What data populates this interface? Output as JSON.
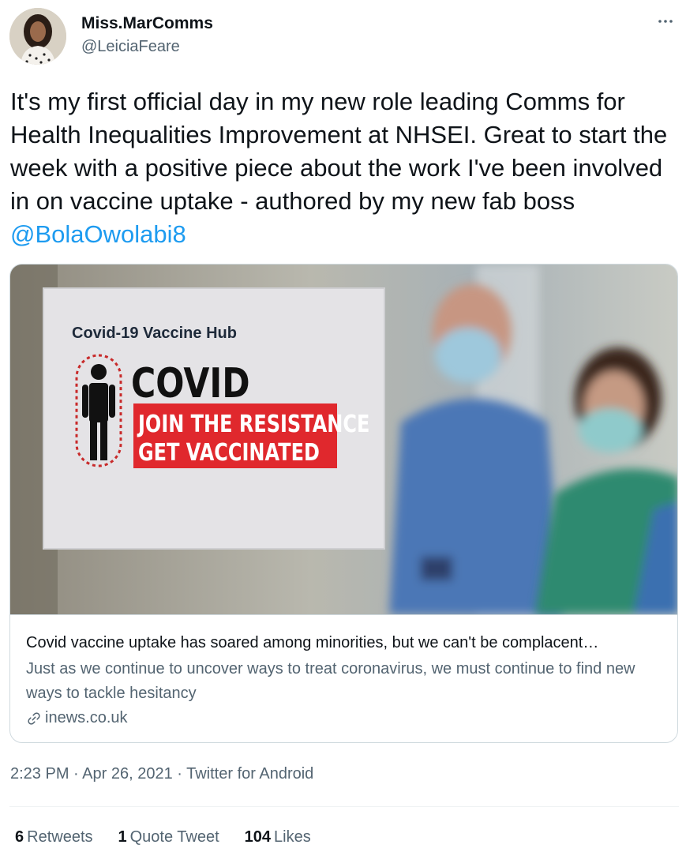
{
  "author": {
    "name": "Miss.MarComms",
    "handle": "@LeiciaFeare"
  },
  "tweet": {
    "text": "It's my first official day in my new role leading Comms for Health Inequalities Improvement at NHSEI. Great to start the week with a positive piece about the work I've been involved in on vaccine uptake - authored by my new fab boss ",
    "mention": "@BolaOwolabi8"
  },
  "card": {
    "image": {
      "sign_heading": "Covid-19 Vaccine Hub",
      "sign_big": "COVID",
      "sign_line1": "JOIN THE RESISTANCE",
      "sign_line2": "GET VACCINATED"
    },
    "title": "Covid vaccine uptake has soared among minorities, but we can't be complacent…",
    "description": "Just as we continue to uncover ways to treat coronavirus, we must continue to find new ways to tackle hesitancy",
    "domain": "inews.co.uk"
  },
  "meta": {
    "time": "2:23 PM",
    "date": "Apr 26, 2021",
    "source": "Twitter for Android",
    "separator": " · "
  },
  "stats": {
    "retweets_count": "6",
    "retweets_label": "Retweets",
    "quotes_count": "1",
    "quotes_label": "Quote Tweet",
    "likes_count": "104",
    "likes_label": "Likes"
  },
  "colors": {
    "link": "#1d9bf0",
    "secondary_text": "#536471",
    "sign_red": "#e0282d"
  }
}
